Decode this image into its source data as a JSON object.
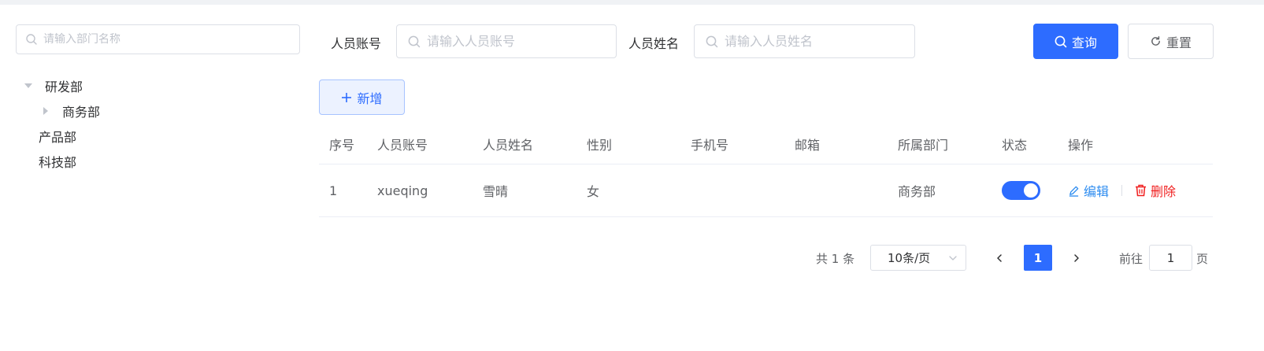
{
  "left_panel": {
    "search": {
      "placeholder": "请输入部门名称"
    },
    "tree": [
      {
        "label": "研发部",
        "expanded": true
      },
      {
        "label": "商务部",
        "expanded": false
      },
      {
        "label": "产品部"
      },
      {
        "label": "科技部"
      }
    ]
  },
  "filters": {
    "account_label": "人员账号",
    "account_placeholder": "请输入人员账号",
    "name_label": "人员姓名",
    "name_placeholder": "请输入人员姓名",
    "search_button": "查询",
    "reset_button": "重置"
  },
  "toolbar": {
    "add_button": "新增"
  },
  "table": {
    "headers": [
      "序号",
      "人员账号",
      "人员姓名",
      "性别",
      "手机号",
      "邮箱",
      "所属部门",
      "状态",
      "操作"
    ],
    "rows": [
      {
        "index": "1",
        "account": "xueqing",
        "name": "雪晴",
        "gender": "女",
        "phone": "",
        "email": "",
        "department": "商务部",
        "status_enabled": true,
        "edit": "编辑",
        "delete": "删除"
      }
    ]
  },
  "pagination": {
    "total": "共 1 条",
    "page_size": "10条/页",
    "current_page": "1",
    "goto_label": "前往",
    "goto_value": "1",
    "goto_suffix": "页"
  },
  "colors": {
    "primary": "#2d6cff",
    "danger": "#f01f1f",
    "link": "#2d8cf0"
  }
}
